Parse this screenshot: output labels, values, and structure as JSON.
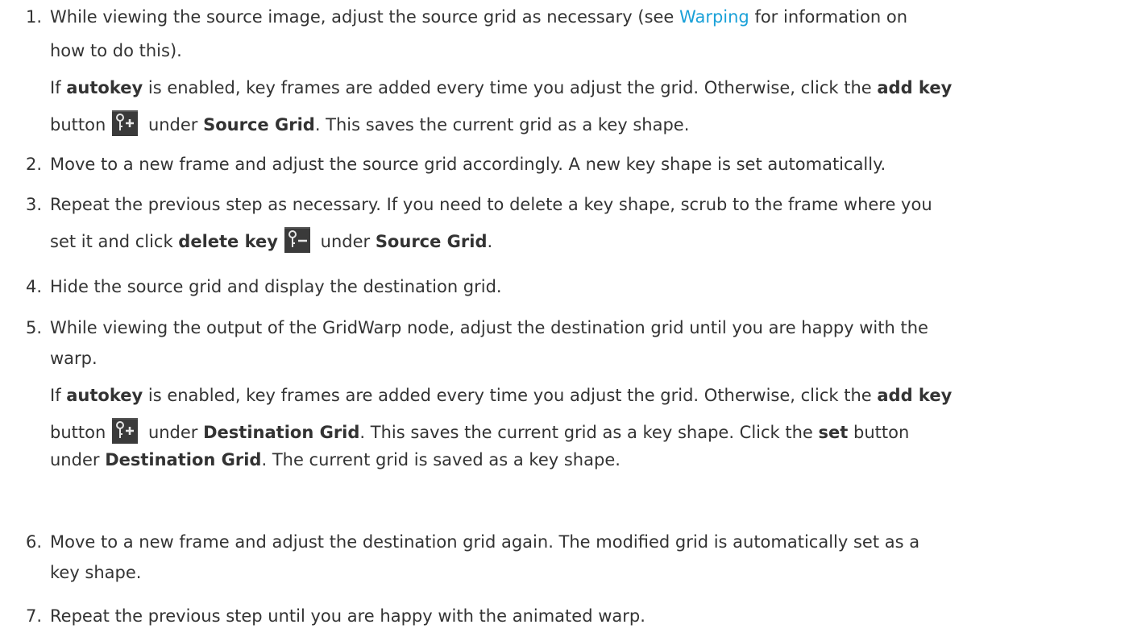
{
  "steps": [
    {
      "num": "1.",
      "line1": {
        "t1": "While viewing the source image, adjust the source grid as necessary (see ",
        "link": "Warping",
        "t2": " for information on"
      },
      "line2": "how to do this).",
      "line3": {
        "t1": "If ",
        "b1": "autokey",
        "t2": " is enabled, key frames are added every time you adjust the grid. Otherwise, click the ",
        "b2": "add key"
      },
      "line4": {
        "t1": "button",
        "t2": " under ",
        "b1": "Source Grid",
        "t3": ". This saves the current grid as a key shape."
      }
    },
    {
      "num": "2.",
      "line1": "Move to a new frame and adjust the source grid accordingly. A new key shape is set automatically."
    },
    {
      "num": "3.",
      "line1": "Repeat the previous step as necessary. If you need to delete a key shape, scrub to the frame where you",
      "line2": {
        "t1": "set it and click ",
        "b1": "delete key",
        "t2": " under ",
        "b2": "Source Grid",
        "t3": "."
      }
    },
    {
      "num": "4.",
      "line1": "Hide the source grid and display the destination grid."
    },
    {
      "num": "5.",
      "line1": "While viewing the output of the GridWarp node, adjust the destination grid until you are happy with the",
      "line2": "warp.",
      "line3": {
        "t1": "If ",
        "b1": "autokey",
        "t2": " is enabled, key frames are added every time you adjust the grid. Otherwise, click the ",
        "b2": "add key"
      },
      "line4": {
        "t1": "button",
        "t2": " under ",
        "b1": "Destination Grid",
        "t3": ". This saves the current grid as a key shape. Click the ",
        "b2": "set",
        "t4": " button"
      },
      "line5": {
        "t1": "under ",
        "b1": "Destination Grid",
        "t2": ". The current grid is saved as a key shape."
      }
    },
    {
      "num": "6.",
      "line1": "Move to a new frame and adjust the destination grid again. The modified grid is automatically set as a",
      "line2": "key shape."
    },
    {
      "num": "7.",
      "line1": "Repeat the previous step until you are happy with the animated warp."
    }
  ],
  "icons": {
    "add_key": "add-key-icon",
    "delete_key": "delete-key-icon"
  },
  "colors": {
    "text": "#333333",
    "link": "#1aa1d8",
    "icon_bg": "#3a3a3a",
    "icon_fg": "#e6e6e6"
  }
}
